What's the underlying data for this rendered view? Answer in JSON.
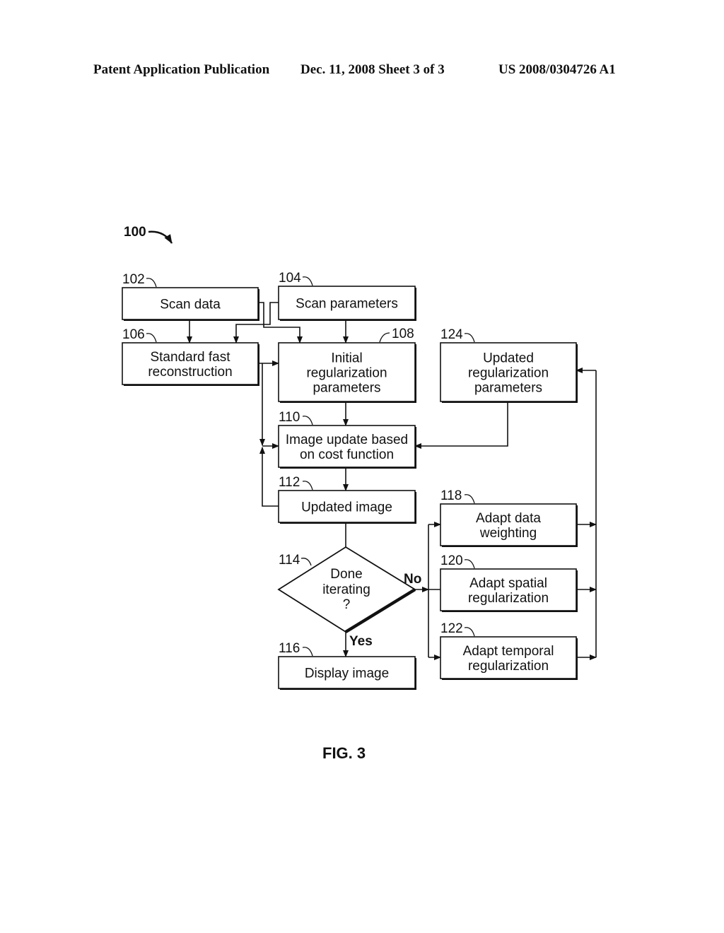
{
  "header": {
    "left": "Patent Application Publication",
    "date_sheet": "Dec. 11, 2008   Sheet 3 of 3",
    "number": "US 2008/0304726 A1"
  },
  "figure": {
    "ref": "100",
    "caption": "FIG. 3"
  },
  "nodes": {
    "scan_data": {
      "ref": "102",
      "lines": [
        "Scan data"
      ]
    },
    "scan_params": {
      "ref": "104",
      "lines": [
        "Scan parameters"
      ]
    },
    "std_fast_recon": {
      "ref": "106",
      "lines": [
        "Standard fast",
        "reconstruction"
      ]
    },
    "init_reg_params": {
      "ref": "108",
      "lines": [
        "Initial",
        "regularization",
        "parameters"
      ]
    },
    "image_update": {
      "ref": "110",
      "lines": [
        "Image update based",
        "on cost function"
      ]
    },
    "updated_image": {
      "ref": "112",
      "lines": [
        "Updated image"
      ]
    },
    "done_iterating": {
      "ref": "114",
      "lines": [
        "Done",
        "iterating",
        "?"
      ]
    },
    "display_image": {
      "ref": "116",
      "lines": [
        "Display image"
      ]
    },
    "adapt_data_weighting": {
      "ref": "118",
      "lines": [
        "Adapt data",
        "weighting"
      ]
    },
    "adapt_spatial_reg": {
      "ref": "120",
      "lines": [
        "Adapt spatial",
        "regularization"
      ]
    },
    "adapt_temporal_reg": {
      "ref": "122",
      "lines": [
        "Adapt temporal",
        "regularization"
      ]
    },
    "updated_reg_params": {
      "ref": "124",
      "lines": [
        "Updated",
        "regularization",
        "parameters"
      ]
    }
  },
  "edge_labels": {
    "no": "No",
    "yes": "Yes"
  }
}
